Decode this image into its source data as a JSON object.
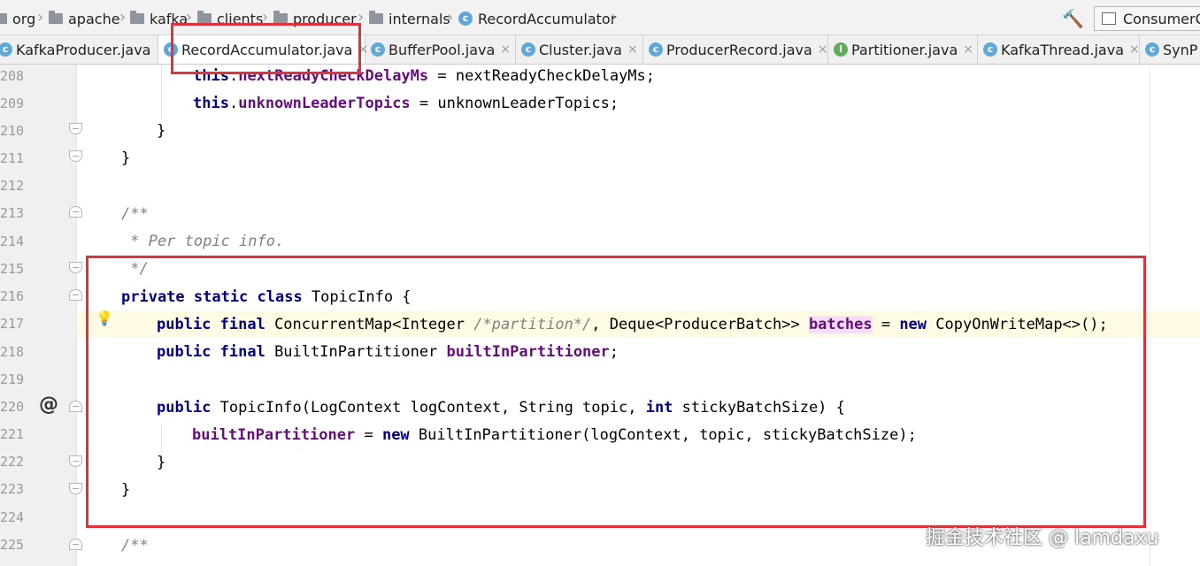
{
  "breadcrumb": {
    "items": [
      {
        "label": "org",
        "icon": "folder-icon"
      },
      {
        "label": "apache",
        "icon": "folder-icon"
      },
      {
        "label": "kafka",
        "icon": "folder-icon"
      },
      {
        "label": "clients",
        "icon": "folder-icon"
      },
      {
        "label": "producer",
        "icon": "folder-icon"
      },
      {
        "label": "internals",
        "icon": "folder-icon"
      },
      {
        "label": "RecordAccumulator",
        "icon": "class-icon",
        "icon_letter": "c"
      }
    ],
    "separator": "›"
  },
  "toolbar": {
    "build_icon": "hammer-icon",
    "run_config_label": "ConsumerOf"
  },
  "tabs": [
    {
      "label": "KafkaProducer.java",
      "icon_letter": "c",
      "icon_color": "#5fa8d8",
      "active": false
    },
    {
      "label": "RecordAccumulator.java",
      "icon_letter": "c",
      "icon_color": "#5fa8d8",
      "active": true
    },
    {
      "label": "BufferPool.java",
      "icon_letter": "c",
      "icon_color": "#5fa8d8",
      "active": false
    },
    {
      "label": "Cluster.java",
      "icon_letter": "c",
      "icon_color": "#5fa8d8",
      "active": false
    },
    {
      "label": "ProducerRecord.java",
      "icon_letter": "c",
      "icon_color": "#5fa8d8",
      "active": false
    },
    {
      "label": "Partitioner.java",
      "icon_letter": "I",
      "icon_color": "#5fae5a",
      "active": false
    },
    {
      "label": "KafkaThread.java",
      "icon_letter": "c",
      "icon_color": "#5fa8d8",
      "active": false
    },
    {
      "label": "SynP",
      "icon_letter": "c",
      "icon_color": "#5fa8d8",
      "active": false
    }
  ],
  "tab_close_glyph": "×",
  "line_numbers": [
    "208",
    "209",
    "210",
    "211",
    "212",
    "213",
    "214",
    "215",
    "216",
    "217",
    "218",
    "219",
    "220",
    "221",
    "222",
    "223",
    "224",
    "225"
  ],
  "code": {
    "l208": {
      "this": "this",
      "dot": ".",
      "field": "nextReadyCheckDelayMs",
      "rest": " = nextReadyCheckDelayMs;"
    },
    "l209": {
      "this": "this",
      "dot": ".",
      "field": "unknownLeaderTopics",
      "rest": " = unknownLeaderTopics;"
    },
    "l210": "}",
    "l211": "}",
    "l213": "/**",
    "l214": " * Per topic info.",
    "l215": " */",
    "l216": {
      "kw": "private static class",
      "rest": " TopicInfo {"
    },
    "l217": {
      "kw1": "public final",
      "t1": " ConcurrentMap<Integer ",
      "cmt": "/*partition*/",
      "t2": ", Deque<ProducerBatch>> ",
      "field": "batches",
      "t3": " = ",
      "kw2": "new",
      "t4": " CopyOnWriteMap<>();"
    },
    "l218": {
      "kw": "public final",
      "t1": " BuiltInPartitioner ",
      "field": "builtInPartitioner",
      "t2": ";"
    },
    "l220": {
      "kw1": "public",
      "t1": " TopicInfo(LogContext logContext, String topic, ",
      "kw2": "int",
      "t2": " stickyBatchSize) {"
    },
    "l221": {
      "field": "builtInPartitioner",
      "t1": " = ",
      "kw": "new",
      "t2": " BuiltInPartitioner(logContext, topic, stickyBatchSize);"
    },
    "l222": "}",
    "l223": "}",
    "l225": "/**"
  },
  "gutter_marks": {
    "intention_icon": "lightbulb-icon",
    "override_marker": "@"
  },
  "watermark": "掘金技术社区 @ lamdaxu",
  "colors": {
    "keyword": "#000080",
    "field": "#660e7a",
    "comment": "#808080",
    "annotation_box": "#e0323a",
    "caret_row": "#fffae3"
  }
}
